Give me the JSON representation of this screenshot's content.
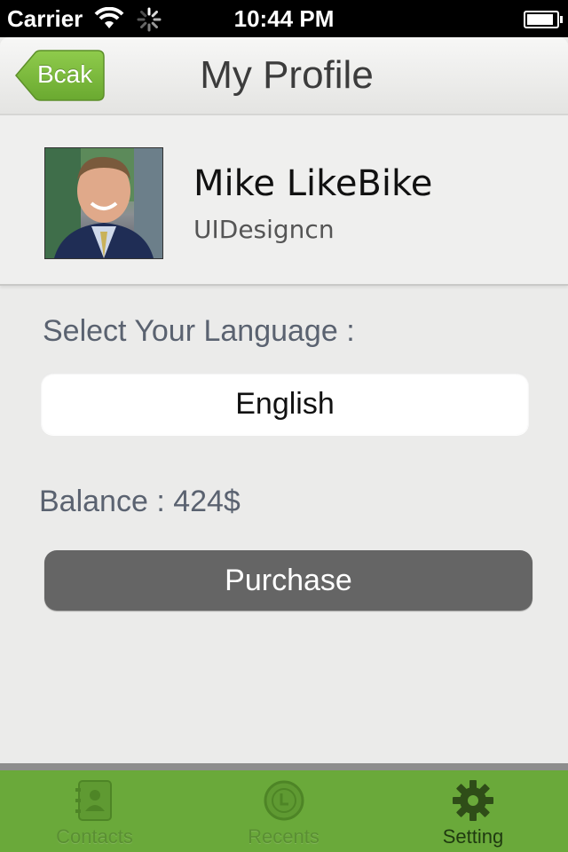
{
  "status_bar": {
    "carrier": "Carrier",
    "time": "10:44 PM",
    "battery_level": 0.9
  },
  "nav": {
    "back_label": "Bcak",
    "title": "My Profile"
  },
  "profile": {
    "name": "Mike LikeBike",
    "organization": "UIDesigncn"
  },
  "language": {
    "label": "Select Your Language :",
    "selected": "English"
  },
  "balance": {
    "text": "Balance : 424$"
  },
  "purchase_button": {
    "label": "Purchase"
  },
  "tabs": [
    {
      "label": "Contacts",
      "icon": "contacts-book-icon",
      "active": false
    },
    {
      "label": "Recents",
      "icon": "clock-icon",
      "active": false
    },
    {
      "label": "Setting",
      "icon": "gear-icon",
      "active": true
    }
  ],
  "colors": {
    "accent_green": "#6aa93a",
    "back_button_green": "#7dbb3c",
    "purchase_gray": "#656565"
  }
}
